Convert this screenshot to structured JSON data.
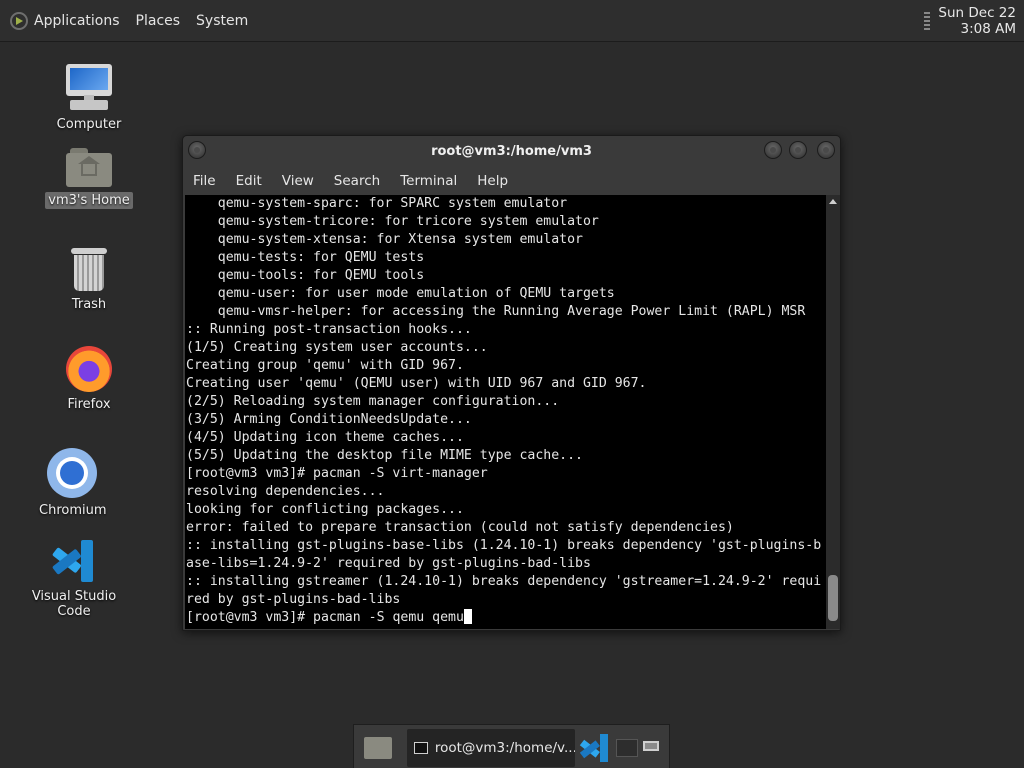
{
  "top_panel": {
    "menus": [
      "Applications",
      "Places",
      "System"
    ],
    "clock_date": "Sun Dec 22",
    "clock_time": "3:08 AM"
  },
  "desktop": {
    "icons": [
      {
        "label": "Computer",
        "icon": "computer-icon"
      },
      {
        "label": "vm3's Home",
        "icon": "home-folder-icon",
        "selected": true
      },
      {
        "label": "Trash",
        "icon": "trash-icon"
      },
      {
        "label": "Firefox",
        "icon": "firefox-icon"
      },
      {
        "label": "Chromium",
        "icon": "chromium-icon"
      },
      {
        "label": "Visual Studio Code",
        "icon": "vscode-icon"
      }
    ]
  },
  "terminal": {
    "title": "root@vm3:/home/vm3",
    "menus": [
      "File",
      "Edit",
      "View",
      "Search",
      "Terminal",
      "Help"
    ],
    "lines": [
      "    qemu-system-sparc: for SPARC system emulator",
      "    qemu-system-tricore: for tricore system emulator",
      "    qemu-system-xtensa: for Xtensa system emulator",
      "    qemu-tests: for QEMU tests",
      "    qemu-tools: for QEMU tools",
      "    qemu-user: for user mode emulation of QEMU targets",
      "    qemu-vmsr-helper: for accessing the Running Average Power Limit (RAPL) MSR",
      ":: Running post-transaction hooks...",
      "(1/5) Creating system user accounts...",
      "Creating group 'qemu' with GID 967.",
      "Creating user 'qemu' (QEMU user) with UID 967 and GID 967.",
      "(2/5) Reloading system manager configuration...",
      "(3/5) Arming ConditionNeedsUpdate...",
      "(4/5) Updating icon theme caches...",
      "(5/5) Updating the desktop file MIME type cache...",
      "[root@vm3 vm3]# pacman -S virt-manager",
      "resolving dependencies...",
      "looking for conflicting packages...",
      "error: failed to prepare transaction (could not satisfy dependencies)",
      ":: installing gst-plugins-base-libs (1.24.10-1) breaks dependency 'gst-plugins-b",
      "ase-libs=1.24.9-2' required by gst-plugins-bad-libs",
      ":: installing gstreamer (1.24.10-1) breaks dependency 'gstreamer=1.24.9-2' requi",
      "red by gst-plugins-bad-libs"
    ],
    "prompt": "[root@vm3 vm3]# ",
    "current_input": "pacman -S qemu qemu"
  },
  "taskbar": {
    "task_label": "root@vm3:/home/v..."
  }
}
